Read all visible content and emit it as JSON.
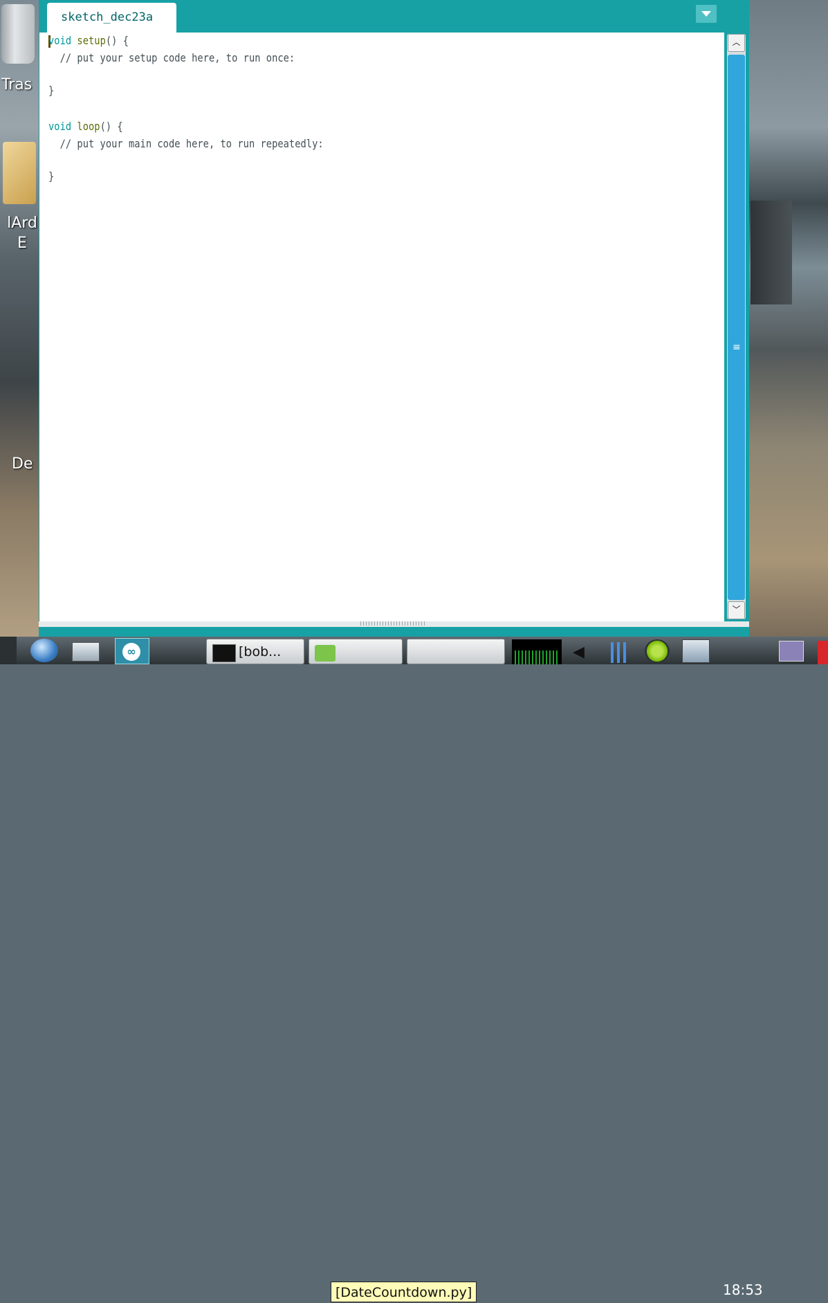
{
  "desktop": {
    "icons": [
      {
        "label": "Tras"
      },
      {
        "label": "lArd\nE"
      },
      {
        "label": "De"
      }
    ]
  },
  "ide": {
    "tab": {
      "label": "sketch_dec23a"
    },
    "code": {
      "lines": [
        {
          "kw": "void",
          "fn": "setup",
          "rest": "() {"
        },
        {
          "comment": "  // put your setup code here, to run once:"
        },
        {
          "text": "}"
        },
        {
          "kw": "void",
          "fn": "loop",
          "rest": "() {"
        },
        {
          "comment": "  // put your main code here, to run repeatedly:"
        },
        {
          "text": "}"
        }
      ]
    },
    "colors": {
      "accent": "#17a1a5",
      "keyword": "#00979c",
      "function": "#5e6d03"
    }
  },
  "taskbar": {
    "items": [
      {
        "label": "[bob..."
      }
    ],
    "tooltip": "[DateCountdown.py]",
    "clock": "18:53"
  }
}
